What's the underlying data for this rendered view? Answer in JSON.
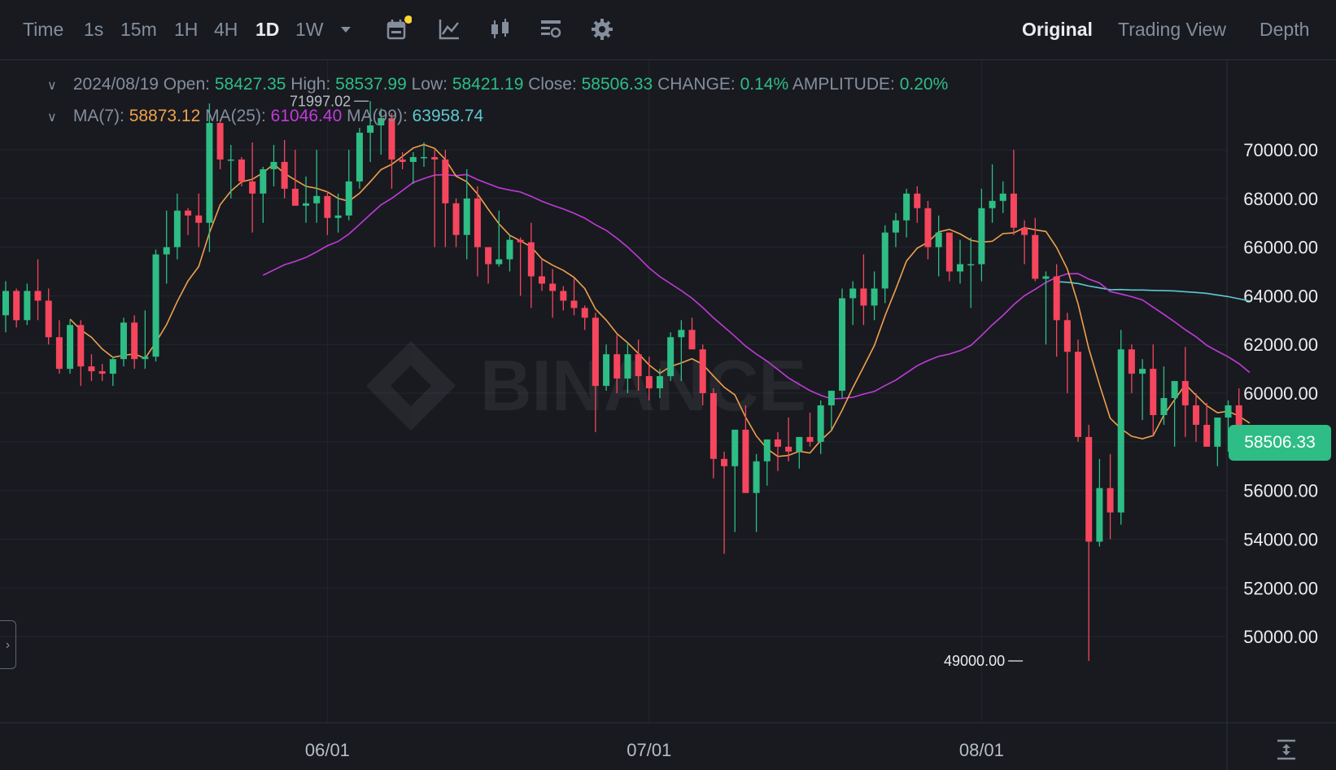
{
  "toolbar": {
    "timeframes": [
      {
        "label": "Time",
        "active": false
      },
      {
        "label": "1s",
        "active": false
      },
      {
        "label": "15m",
        "active": false
      },
      {
        "label": "1H",
        "active": false
      },
      {
        "label": "4H",
        "active": false
      },
      {
        "label": "1D",
        "active": true
      },
      {
        "label": "1W",
        "active": false
      }
    ],
    "more_icon": "caret-down-icon",
    "tool_icons": [
      "calendar-icon",
      "indicator-icon",
      "candle-type-icon",
      "layout-icon",
      "settings-icon"
    ],
    "notification_dot_color": "#fcd535",
    "views": [
      {
        "label": "Original",
        "active": true
      },
      {
        "label": "Trading View",
        "active": false
      },
      {
        "label": "Depth",
        "active": false
      }
    ]
  },
  "ohlc": {
    "date": "2024/08/19",
    "open_label": "Open:",
    "open": "58427.35",
    "high_label": "High:",
    "high": "58537.99",
    "low_label": "Low:",
    "low": "58421.19",
    "close_label": "Close:",
    "close": "58506.33",
    "change_label": "CHANGE:",
    "change": "0.14%",
    "amplitude_label": "AMPLITUDE:",
    "amplitude": "0.20%"
  },
  "ma": {
    "ma7_label": "MA(7):",
    "ma7": "58873.12",
    "ma25_label": "MA(25):",
    "ma25": "61046.40",
    "ma99_label": "MA(99):",
    "ma99": "63958.74"
  },
  "colors": {
    "up": "#2ebd85",
    "down": "#f6465d",
    "ma7": "#f0a04b",
    "ma25": "#c23ad9",
    "ma99": "#5ec8d0",
    "background": "#181a20",
    "grid": "#23262d"
  },
  "chart_data": {
    "type": "candlestick",
    "y_ticks": [
      "70000.00",
      "68000.00",
      "66000.00",
      "64000.00",
      "62000.00",
      "60000.00",
      "56000.00",
      "54000.00",
      "52000.00",
      "50000.00"
    ],
    "ylim": [
      48000,
      71500
    ],
    "x_ticks": [
      {
        "label": "06/01",
        "index": 30
      },
      {
        "label": "07/01",
        "index": 60
      },
      {
        "label": "08/01",
        "index": 91
      }
    ],
    "last_price": "58506.33",
    "high_marker": {
      "label": "71997.02",
      "index": 34,
      "value": 71997.02
    },
    "low_marker": {
      "label": "49000.00",
      "index": 95,
      "value": 49000
    },
    "candles": [
      [
        63200,
        64600,
        62500,
        64200
      ],
      [
        64200,
        64300,
        62700,
        63000
      ],
      [
        63000,
        64500,
        62800,
        64200
      ],
      [
        64200,
        65500,
        63000,
        63800
      ],
      [
        63800,
        64300,
        62000,
        62300
      ],
      [
        62300,
        63000,
        60800,
        61000
      ],
      [
        61000,
        63000,
        60800,
        62800
      ],
      [
        62800,
        63000,
        60300,
        61100
      ],
      [
        61100,
        61600,
        60500,
        60900
      ],
      [
        60900,
        61200,
        60500,
        60800
      ],
      [
        60800,
        61500,
        60300,
        61400
      ],
      [
        61400,
        63100,
        61100,
        62900
      ],
      [
        62900,
        63200,
        61000,
        61400
      ],
      [
        61400,
        63400,
        61000,
        61500
      ],
      [
        61500,
        65900,
        61300,
        65700
      ],
      [
        65700,
        67500,
        64500,
        66000
      ],
      [
        66000,
        68200,
        65500,
        67500
      ],
      [
        67500,
        67600,
        66500,
        67300
      ],
      [
        67300,
        68200,
        66000,
        67000
      ],
      [
        67000,
        71900,
        65800,
        71100
      ],
      [
        71100,
        71200,
        69200,
        69600
      ],
      [
        69600,
        70200,
        68000,
        69600
      ],
      [
        69600,
        69700,
        68500,
        68700
      ],
      [
        68700,
        70300,
        66600,
        68200
      ],
      [
        68200,
        69300,
        67000,
        69200
      ],
      [
        69200,
        70200,
        68500,
        69500
      ],
      [
        69500,
        70400,
        68000,
        68400
      ],
      [
        68400,
        70000,
        67800,
        67700
      ],
      [
        67700,
        68900,
        67000,
        67800
      ],
      [
        67800,
        70000,
        67000,
        68100
      ],
      [
        68100,
        68300,
        66500,
        67200
      ],
      [
        67200,
        68200,
        66600,
        67300
      ],
      [
        67300,
        70000,
        67100,
        68700
      ],
      [
        68700,
        70900,
        68400,
        70700
      ],
      [
        70700,
        71997,
        69500,
        71000
      ],
      [
        71000,
        71700,
        69800,
        71300
      ],
      [
        71300,
        71500,
        68400,
        69600
      ],
      [
        69600,
        69900,
        69200,
        69500
      ],
      [
        69500,
        69900,
        68600,
        69700
      ],
      [
        69700,
        70300,
        69300,
        69700
      ],
      [
        69700,
        70000,
        66000,
        69600
      ],
      [
        69600,
        70000,
        66000,
        67800
      ],
      [
        67800,
        68000,
        66000,
        66500
      ],
      [
        66500,
        69200,
        65500,
        68000
      ],
      [
        68000,
        68500,
        64800,
        66000
      ],
      [
        66000,
        66000,
        64500,
        65300
      ],
      [
        65300,
        67500,
        65200,
        65500
      ],
      [
        65500,
        66500,
        65000,
        66300
      ],
      [
        66300,
        66400,
        64000,
        66200
      ],
      [
        66200,
        67000,
        63500,
        64800
      ],
      [
        64800,
        65500,
        64200,
        64500
      ],
      [
        64500,
        65100,
        63100,
        64200
      ],
      [
        64200,
        64400,
        63400,
        63800
      ],
      [
        63800,
        64700,
        63200,
        63500
      ],
      [
        63500,
        63600,
        62600,
        63100
      ],
      [
        63100,
        63300,
        58400,
        60300
      ],
      [
        60300,
        62000,
        60100,
        61600
      ],
      [
        61600,
        62400,
        60000,
        60600
      ],
      [
        60600,
        62100,
        60000,
        61600
      ],
      [
        61600,
        62200,
        60100,
        60700
      ],
      [
        60700,
        61500,
        59700,
        60200
      ],
      [
        60200,
        61000,
        59800,
        60700
      ],
      [
        60700,
        62500,
        60500,
        62300
      ],
      [
        62300,
        63000,
        60500,
        62600
      ],
      [
        62600,
        63100,
        61900,
        61800
      ],
      [
        61800,
        62000,
        59500,
        60000
      ],
      [
        60000,
        60200,
        56500,
        57300
      ],
      [
        57300,
        57600,
        53400,
        57000
      ],
      [
        57000,
        57100,
        54300,
        58500
      ],
      [
        58500,
        59500,
        56400,
        55900
      ],
      [
        55900,
        57500,
        54300,
        57200
      ],
      [
        57200,
        58100,
        56200,
        58100
      ],
      [
        58100,
        58400,
        56800,
        57800
      ],
      [
        57800,
        59000,
        57200,
        57600
      ],
      [
        57600,
        58200,
        56900,
        58200
      ],
      [
        58200,
        59200,
        57800,
        58000
      ],
      [
        58000,
        59700,
        57500,
        59500
      ],
      [
        59500,
        60000,
        58500,
        60100
      ],
      [
        60100,
        64300,
        59800,
        63900
      ],
      [
        63900,
        64600,
        62800,
        64300
      ],
      [
        64300,
        65700,
        62800,
        63600
      ],
      [
        63600,
        65000,
        63000,
        64300
      ],
      [
        64300,
        66900,
        63700,
        66600
      ],
      [
        66600,
        67400,
        66000,
        67100
      ],
      [
        67100,
        68400,
        66400,
        68200
      ],
      [
        68200,
        68500,
        67000,
        67600
      ],
      [
        67600,
        67900,
        65500,
        66000
      ],
      [
        66000,
        67300,
        64800,
        66600
      ],
      [
        66600,
        66600,
        64600,
        65000
      ],
      [
        65000,
        66300,
        64500,
        65300
      ],
      [
        65300,
        66400,
        63500,
        65300
      ],
      [
        65300,
        68400,
        64600,
        67600
      ],
      [
        67600,
        69400,
        67000,
        67900
      ],
      [
        67900,
        68700,
        67400,
        68200
      ],
      [
        68200,
        70000,
        66500,
        66800
      ],
      [
        66800,
        67100,
        65300,
        66500
      ],
      [
        66500,
        67200,
        64600,
        64700
      ],
      [
        64700,
        65000,
        62000,
        64800
      ],
      [
        64800,
        65300,
        61500,
        63000
      ],
      [
        63000,
        63300,
        60000,
        61700
      ],
      [
        61700,
        62200,
        58000,
        58200
      ],
      [
        58200,
        58700,
        49000,
        53900
      ],
      [
        53900,
        57300,
        53700,
        56100
      ],
      [
        56100,
        57500,
        54000,
        55100
      ],
      [
        55100,
        62600,
        54600,
        61800
      ],
      [
        61800,
        62000,
        60000,
        60800
      ],
      [
        60800,
        61400,
        58900,
        61000
      ],
      [
        61000,
        62000,
        58300,
        59100
      ],
      [
        59100,
        61100,
        58700,
        59800
      ],
      [
        59800,
        60400,
        57800,
        60500
      ],
      [
        60500,
        61900,
        58200,
        59500
      ],
      [
        59500,
        60000,
        58000,
        58700
      ],
      [
        58700,
        59600,
        58000,
        57800
      ],
      [
        57800,
        58700,
        57000,
        59000
      ],
      [
        59000,
        59700,
        57600,
        59500
      ],
      [
        59500,
        60200,
        58900,
        58400
      ],
      [
        58427,
        58538,
        58421,
        58506
      ]
    ]
  }
}
